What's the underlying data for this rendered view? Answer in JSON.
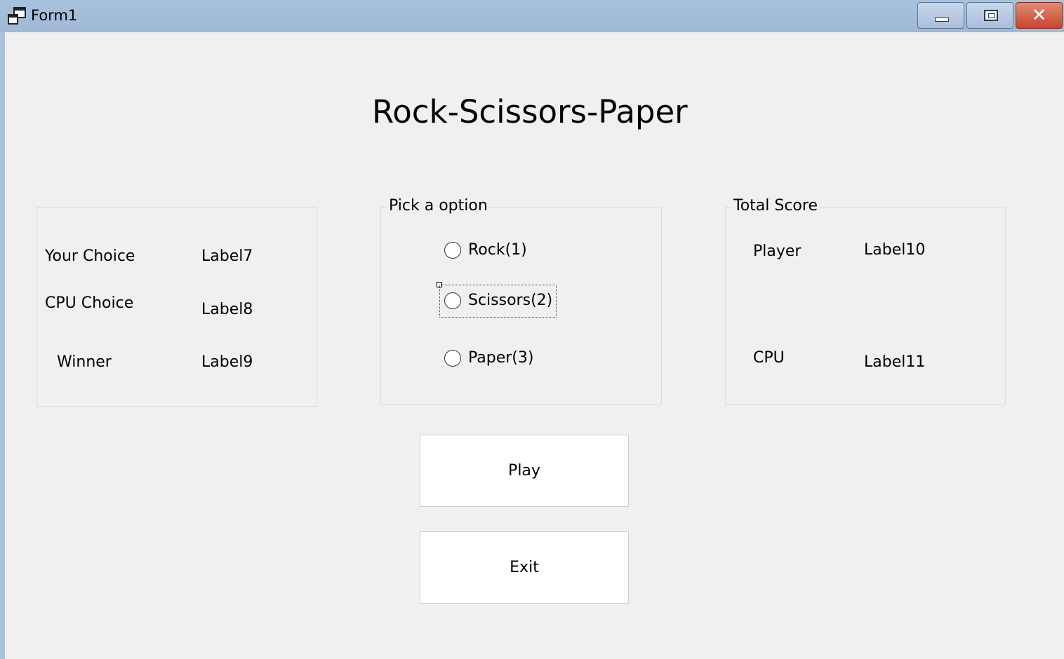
{
  "window": {
    "title": "Form1",
    "icon": "app-window-icon",
    "controls": {
      "minimize": "minimize-icon",
      "maximize": "maximize-icon",
      "close": "close-icon",
      "close_glyph": "✕"
    }
  },
  "heading": "Rock-Scissors-Paper",
  "results_group": {
    "rows": [
      {
        "label": "Your Choice",
        "value": "Label7"
      },
      {
        "label": "CPU Choice",
        "value": "Label8"
      },
      {
        "label": "Winner",
        "value": "Label9"
      }
    ]
  },
  "option_group": {
    "legend": "Pick a option",
    "options": [
      {
        "label": "Rock(1)",
        "checked": false
      },
      {
        "label": "Scissors(2)",
        "checked": false,
        "focused": true
      },
      {
        "label": "Paper(3)",
        "checked": false
      }
    ]
  },
  "score_group": {
    "legend": "Total Score",
    "rows": [
      {
        "label": "Player",
        "value": "Label10"
      },
      {
        "label": "CPU",
        "value": "Label11"
      }
    ]
  },
  "buttons": {
    "play": "Play",
    "exit": "Exit"
  },
  "colors": {
    "form_bg": "#f0f0f0",
    "titlebar": "#a8c2de",
    "close_button": "#c7462b"
  }
}
